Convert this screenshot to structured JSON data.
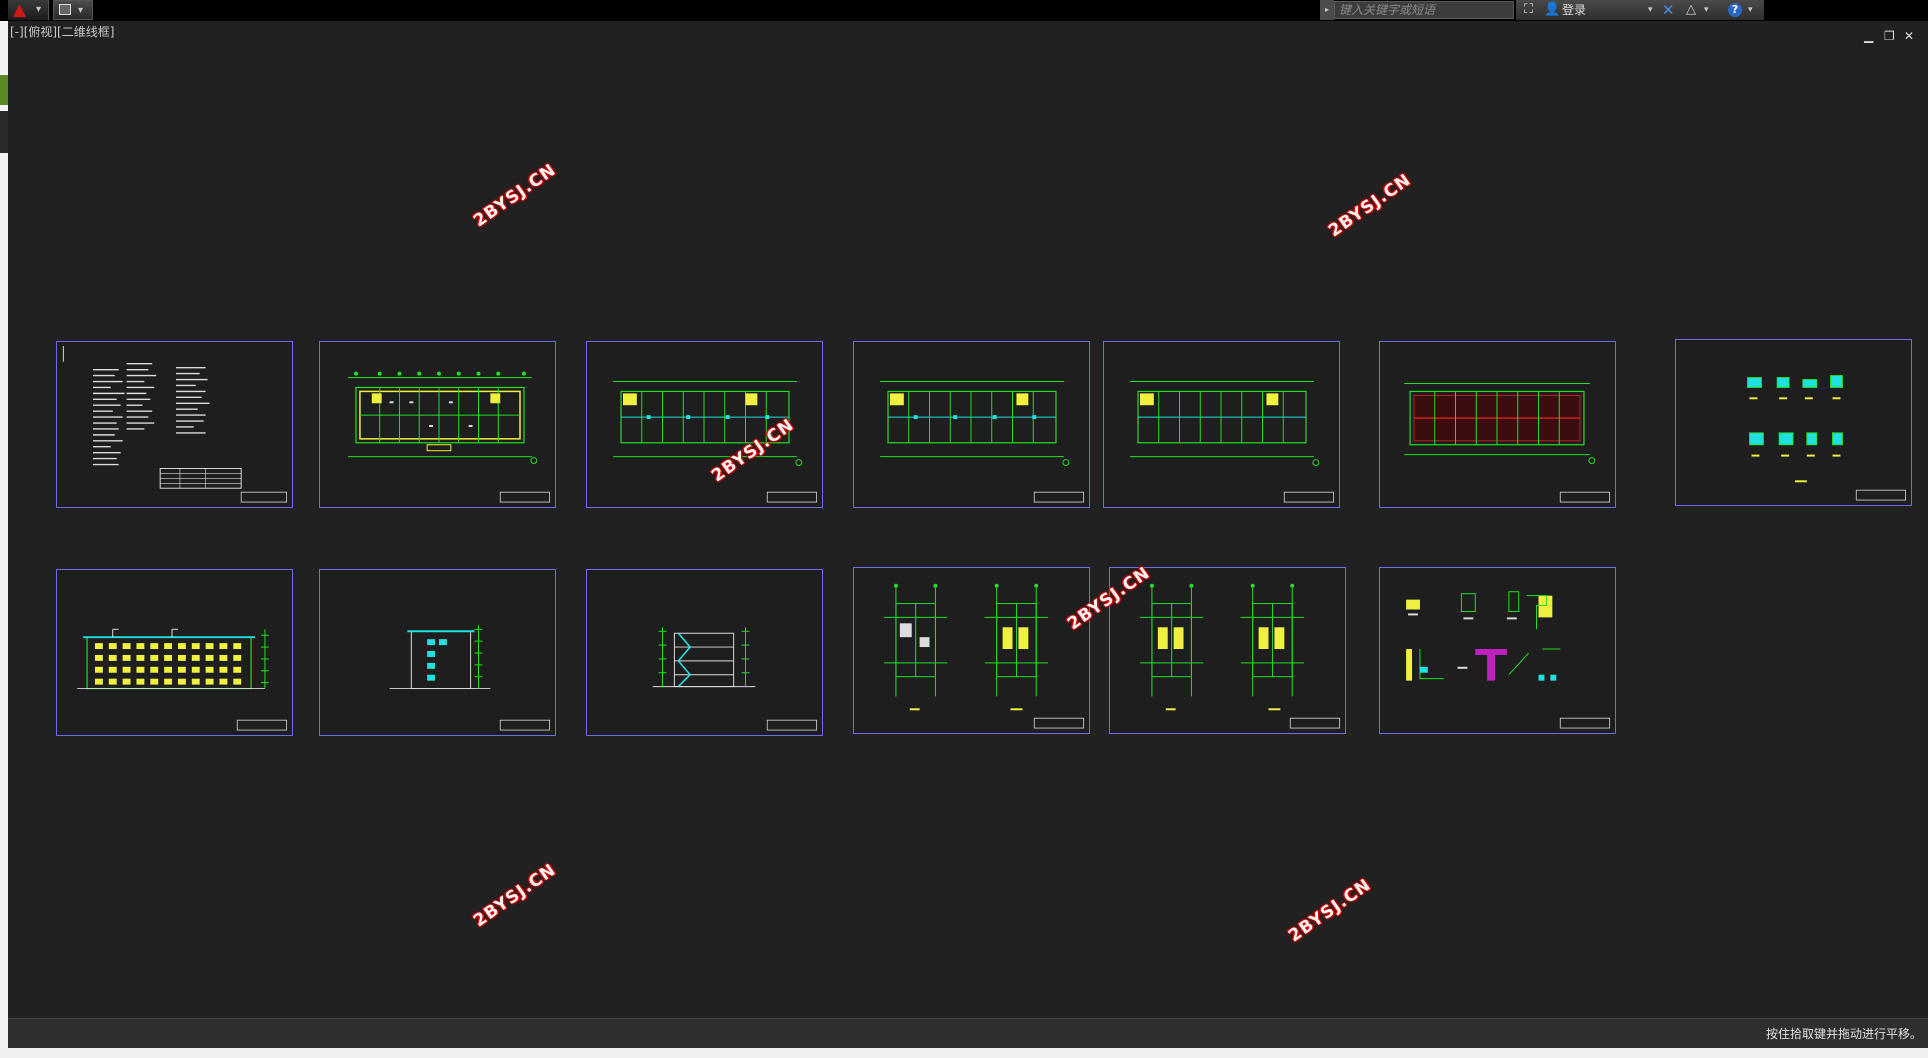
{
  "titlebar": {
    "search_placeholder": "键入关键字或短语",
    "login_label": "登录",
    "icons": [
      "autocad-logo-icon",
      "quick-access-icon",
      "binoculars-icon",
      "user-icon",
      "exchange-icon",
      "a360-icon",
      "help-icon"
    ]
  },
  "viewport": {
    "label": "[-][俯视][二维线框]"
  },
  "watermark": {
    "text": "2BYSJ.CN"
  },
  "statusbar": {
    "text": "按住拾取键并拖动进行平移。"
  },
  "colors": {
    "background": "#212121",
    "sheet_border": "#6c6cf0",
    "cad_green": "#22e022",
    "cad_yellow": "#f0f040",
    "cad_cyan": "#20e0e0",
    "cad_red": "#e02020",
    "watermark_glow": "#dd0000"
  },
  "sheets": [
    {
      "row": 1,
      "kind": "design-notes"
    },
    {
      "row": 1,
      "kind": "floor-plan-1"
    },
    {
      "row": 1,
      "kind": "floor-plan-2"
    },
    {
      "row": 1,
      "kind": "floor-plan-3"
    },
    {
      "row": 1,
      "kind": "floor-plan-4"
    },
    {
      "row": 1,
      "kind": "roof-plan"
    },
    {
      "row": 1,
      "kind": "window-details"
    },
    {
      "row": 2,
      "kind": "front-elevation"
    },
    {
      "row": 2,
      "kind": "side-elevation"
    },
    {
      "row": 2,
      "kind": "section"
    },
    {
      "row": 2,
      "kind": "stair-plans-a"
    },
    {
      "row": 2,
      "kind": "stair-plans-b"
    },
    {
      "row": 2,
      "kind": "node-details"
    }
  ]
}
